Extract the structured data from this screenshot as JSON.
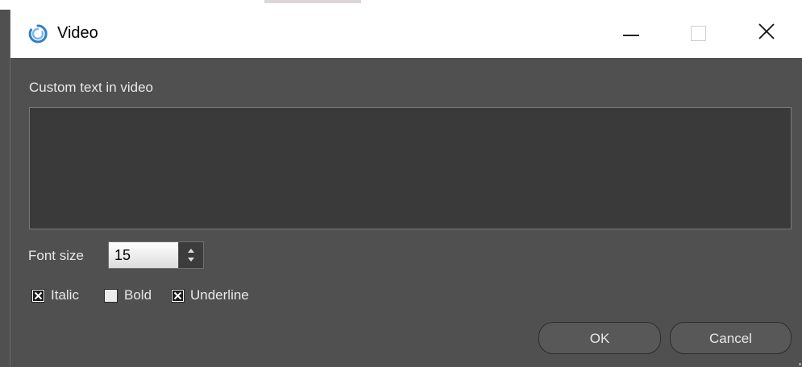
{
  "window": {
    "title": "Video",
    "icon": "circular-arrow-icon",
    "accent": "#2f80c8"
  },
  "form": {
    "custom_text_label": "Custom text in video",
    "custom_text_value": "",
    "font_size_label": "Font size",
    "font_size_value": "15",
    "italic": {
      "label": "Italic",
      "checked": true
    },
    "bold": {
      "label": "Bold",
      "checked": false
    },
    "underline": {
      "label": "Underline",
      "checked": true
    }
  },
  "buttons": {
    "ok": "OK",
    "cancel": "Cancel"
  }
}
